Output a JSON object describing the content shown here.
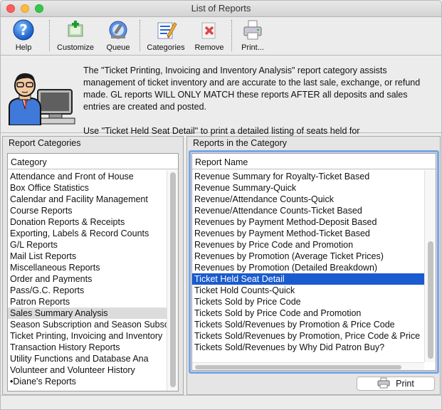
{
  "window": {
    "title": "List of Reports"
  },
  "toolbar": {
    "buttons": [
      {
        "label": "Help",
        "icon": "help-icon"
      },
      {
        "label": "Customize",
        "icon": "customize-icon"
      },
      {
        "label": "Queue",
        "icon": "queue-icon"
      },
      {
        "label": "Categories",
        "icon": "categories-icon"
      },
      {
        "label": "Remove",
        "icon": "remove-icon"
      },
      {
        "label": "Print...",
        "icon": "printer-icon"
      }
    ]
  },
  "info": {
    "paragraph1": "The \"Ticket Printing, Invoicing and Inventory Analysis\" report category assists management of ticket inventory and are accurate to the last sale, exchange, or refund made. GL reports WILL ONLY MATCH these reports AFTER all deposits and sales entries are created and posted.",
    "paragraph2": "Use \"Ticket Held Seat Detail\" to print a detailed listing of seats held for"
  },
  "categories_panel": {
    "title": "Report Categories",
    "column_header": "Category",
    "selected_index": 12,
    "items": [
      "Attendance and Front of House",
      "Box Office Statistics",
      "Calendar and Facility Management",
      "Course Reports",
      "Donation Reports & Receipts",
      "Exporting, Labels & Record Counts",
      "G/L Reports",
      "Mail List Reports",
      "Miscellaneous Reports",
      "Order and Payments",
      "Pass/G.C. Reports",
      "Patron Reports",
      "Sales Summary Analysis",
      "Season Subscription and Season Subscripti",
      "Ticket Printing, Invoicing and Inventory",
      "Transaction History Reports",
      "Utility Functions and Database Ana",
      "Volunteer and Volunteer History",
      "•Diane's Reports"
    ]
  },
  "reports_panel": {
    "title": "Reports in the Category",
    "column_header": "Report Name",
    "selected_index": 9,
    "items": [
      "Revenue Summary for Royalty-Ticket Based",
      "Revenue Summary-Quick",
      "Revenue/Attendance Counts-Quick",
      "Revenue/Attendance Counts-Ticket Based",
      "Revenues by Payment Method-Deposit Based",
      "Revenues by Payment Method-Ticket Based",
      "Revenues by Price Code and Promotion",
      "Revenues by Promotion (Average Ticket Prices)",
      "Revenues by Promotion (Detailed Breakdown)",
      "Ticket Held Seat Detail",
      "Ticket Hold Counts-Quick",
      "Tickets Sold by Price Code",
      "Tickets Sold by Price Code and Promotion",
      "Tickets Sold/Revenues by Promotion & Price Code",
      "Tickets Sold/Revenues by Promotion, Price Code & Price",
      "Tickets Sold/Revenues by Why Did Patron Buy?"
    ]
  },
  "print_button": {
    "label": "Print",
    "icon": "printer-icon"
  },
  "colors": {
    "selection": "#1a5bd0",
    "focus": "#7aa6e6"
  }
}
